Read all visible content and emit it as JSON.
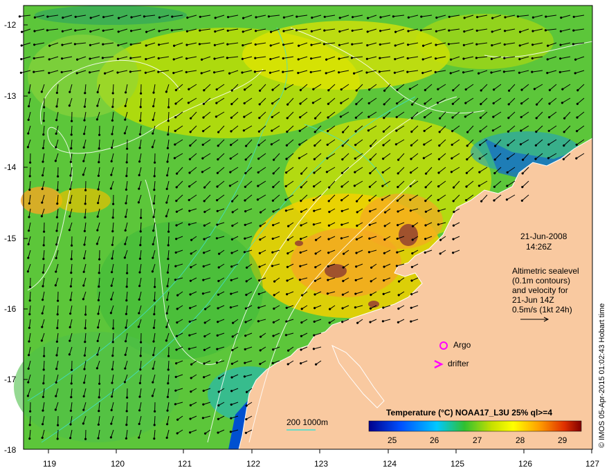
{
  "map": {
    "date": "21-Jun-2008",
    "time": "14:26Z",
    "velocity_note": "Altimetric sealevel\n(0.1m contours)\nand velocity for\n21-Jun 14Z",
    "scale_label": "0.5m/s (1kt 24h)",
    "argo_label": "Argo",
    "drifter_label": "drifter",
    "bathy_label": "200  1000m",
    "credit": "© IMOS 05-Apr-2015 01:02:43 Hobart time",
    "y_ticks": [
      "-12",
      "-13",
      "-14",
      "-15",
      "-16",
      "-17",
      "-18"
    ],
    "x_ticks": [
      "119",
      "120",
      "121",
      "122",
      "123",
      "124",
      "125",
      "126",
      "127"
    ],
    "colorbar": {
      "title": "Temperature (°C) NOAA17_L3U 25% ql>=4",
      "ticks": [
        "25",
        "26",
        "27",
        "28",
        "29"
      ],
      "range": [
        24.5,
        29.5
      ]
    },
    "colors": {
      "land": "#f9c9a0",
      "ocean_base": "#5cc63a",
      "warm": "#f5a623",
      "hot": "#a0522d",
      "argo_marker": "#ff00ff",
      "contour": "#ffffff",
      "bathy": "#40e0d0"
    }
  }
}
